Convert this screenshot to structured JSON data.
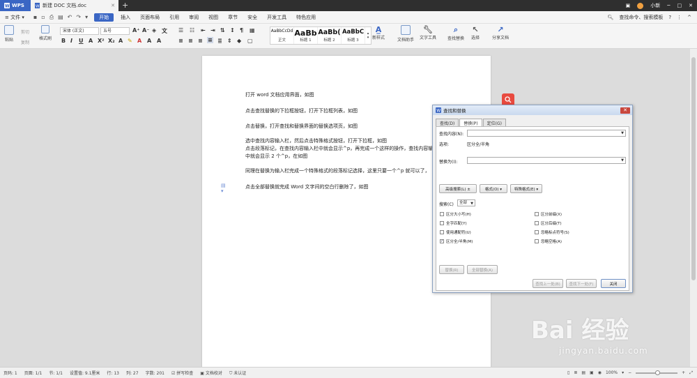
{
  "titlebar": {
    "app_tab": "WPS",
    "doc_tab": "新建 DOC 文档.doc",
    "user": "小新"
  },
  "menubar": {
    "file": "文件",
    "items": [
      "开始",
      "插入",
      "页面布局",
      "引用",
      "审阅",
      "视图",
      "章节",
      "安全",
      "开发工具",
      "特色应用"
    ],
    "active": "开始",
    "search": "查找命令、搜索模板"
  },
  "ribbon": {
    "paste": "粘贴",
    "cut": "剪切",
    "copy": "复制",
    "format_painter": "格式刷",
    "font_name": "宋体 (正文)",
    "font_size": "五号",
    "styles": [
      {
        "sample": "AaBbCcDd",
        "label": "正文"
      },
      {
        "sample": "AaBb",
        "label": "标题 1"
      },
      {
        "sample": "AaBb(",
        "label": "标题 2"
      },
      {
        "sample": "AaBbC",
        "label": "标题 3"
      }
    ],
    "new_style": "新样式",
    "doc_helper": "文档助手",
    "text_tools": "文字工具",
    "find_replace": "查找替换",
    "select": "选择",
    "share_doc": "分享文档"
  },
  "document": {
    "paragraphs": [
      "打开 word 文档应用界面，如图",
      "点击查找替换的下拉框按钮，打开下拉框列表，如图",
      "点击替换，打开查找和替换界面的替换选项页，如图",
      "选中查找内容输入栏，然后点击特殊格式按钮，打开下拉框，如图",
      "点击段落标记，在查找内容输入栏中就会显示^p，再完成一个这样的操作，查找内容输",
      "中就会显示 2 个^p，在如图",
      "同理在替换为输入栏完成一个特殊格式的段落标记选择，这里只要一个^p 就可以了，",
      "点击全部替换就完成 Word 文字间的空白行删除了，如图"
    ]
  },
  "dialog": {
    "title": "查找和替换",
    "tabs": [
      "查找(D)",
      "替换(P)",
      "定位(G)"
    ],
    "active_tab": "替换(P)",
    "find_label": "查找内容(N):",
    "find_value": "",
    "options_label": "选项:",
    "options_value": "区分全/半角",
    "replace_label": "替换为(I):",
    "replace_value": "",
    "advanced_btn": "高级搜索(L) ±",
    "format_btn": "格式(O) ▾",
    "special_btn": "特殊格式(E) ▾",
    "search_label": "搜索(C)",
    "search_value": "全部",
    "checkboxes_left": [
      {
        "label": "区分大小写(H)",
        "checked": false
      },
      {
        "label": "全字匹配(Y)",
        "checked": false
      },
      {
        "label": "使用通配符(U)",
        "checked": false
      },
      {
        "label": "区分全/半角(M)",
        "checked": true
      }
    ],
    "checkboxes_right": [
      {
        "label": "区分前缀(X)",
        "checked": false
      },
      {
        "label": "区分后缀(T)",
        "checked": false
      },
      {
        "label": "忽略标点符号(S)",
        "checked": false
      },
      {
        "label": "忽略空格(A)",
        "checked": false
      }
    ],
    "replace_btn": "替换(R)",
    "replace_all_btn": "全部替换(A)",
    "find_prev_btn": "查找上一处(B)",
    "find_next_btn": "查找下一处(F)",
    "close_btn": "关闭"
  },
  "statusbar": {
    "page": "页码: 1",
    "pages": "页面: 1/1",
    "section": "节: 1/1",
    "position": "设置值: 9.1厘米",
    "row": "行: 13",
    "col": "列: 27",
    "words": "字数: 201",
    "spell": "拼写检查",
    "proof": "文档校对",
    "auth": "未认证",
    "zoom": "100%"
  },
  "watermark": {
    "main": "Bai 经验",
    "sub": "jingyan.baidu.com"
  }
}
